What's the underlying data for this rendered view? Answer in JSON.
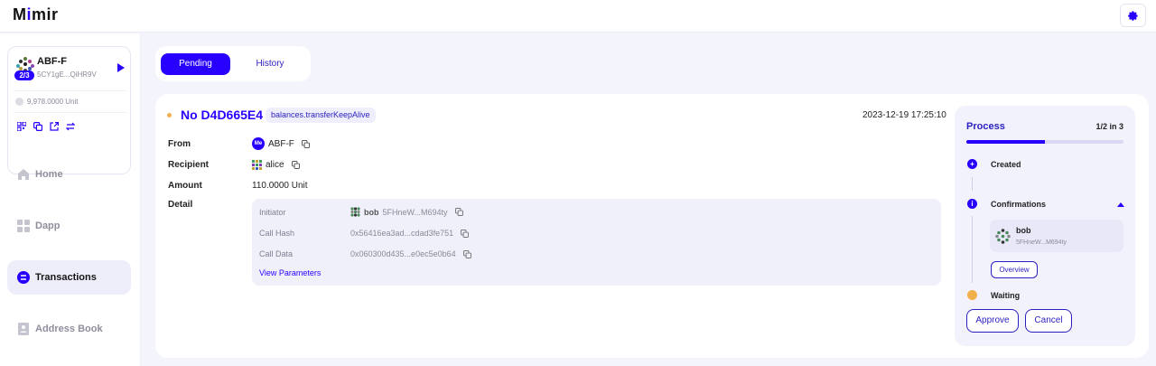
{
  "app": {
    "logo_text_pre": "M",
    "logo_text_i": "i",
    "logo_text_post": "mir"
  },
  "header": {
    "settings_icon": "gear-icon"
  },
  "account": {
    "name": "ABF-F",
    "threshold_badge": "2/3",
    "address": "5CY1gE...QiHR9V",
    "balance": "9,978.0000 Unit",
    "actions": [
      "qr-icon",
      "copy-icon",
      "external-link-icon",
      "switch-icon"
    ]
  },
  "nav": [
    {
      "label": "Home",
      "icon": "home-icon",
      "active": false
    },
    {
      "label": "Dapp",
      "icon": "dapp-icon",
      "active": false
    },
    {
      "label": "Transactions",
      "icon": "transactions-icon",
      "active": true
    },
    {
      "label": "Address Book",
      "icon": "address-book-icon",
      "active": false
    }
  ],
  "tabs": {
    "pending": "Pending",
    "history": "History",
    "active": "pending"
  },
  "transaction": {
    "title": "No D4D665E4",
    "method": "balances.transferKeepAlive",
    "timestamp": "2023-12-19 17:25:10",
    "status_color": "#f2b04a",
    "labels": {
      "from": "From",
      "recipient": "Recipient",
      "amount": "Amount",
      "detail": "Detail"
    },
    "from": {
      "badge": "Me",
      "name": "ABF-F"
    },
    "recipient": {
      "name": "alice"
    },
    "amount": "110.0000 Unit",
    "detail": {
      "initiator_label": "Initiator",
      "initiator_name": "bob",
      "initiator_addr": "5FHneW...M694ty",
      "call_hash_label": "Call Hash",
      "call_hash": "0x56416ea3ad...cdad3fe751",
      "call_data_label": "Call Data",
      "call_data": "0x060300d435...e0ec5e0b64",
      "view_params": "View Parameters"
    }
  },
  "process": {
    "title": "Process",
    "count": "1/2 in 3",
    "progress": 0.5,
    "steps": {
      "created": "Created",
      "confirmations": "Confirmations",
      "waiting": "Waiting"
    },
    "signer": {
      "name": "bob",
      "address": "5FHneW...M694ty"
    },
    "overview": "Overview",
    "approve": "Approve",
    "cancel": "Cancel"
  },
  "colors": {
    "accent": "#2700ff",
    "pending_dot": "#f2b04a"
  }
}
